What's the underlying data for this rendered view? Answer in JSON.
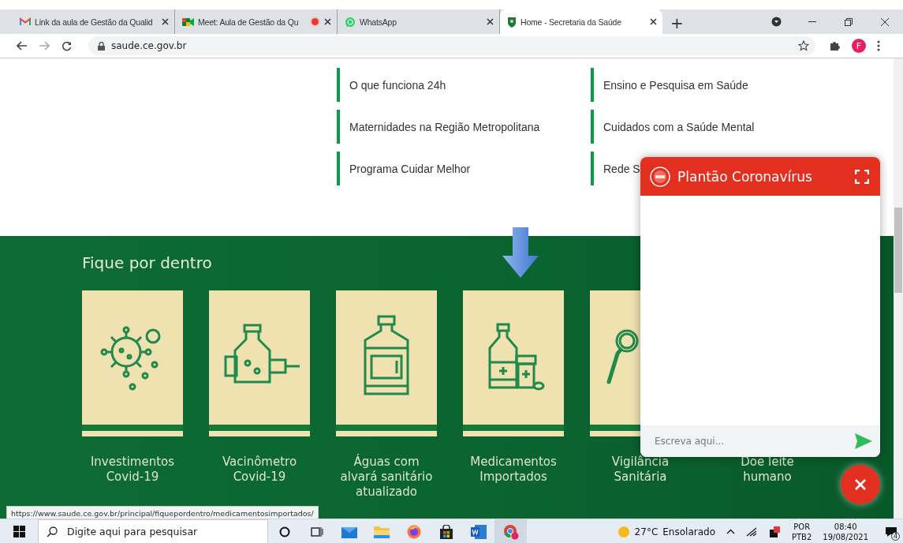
{
  "browser": {
    "tabs": [
      {
        "kind": "gmail",
        "title": "Link da aula de Gestão da Qualid",
        "selected": false,
        "recording": false
      },
      {
        "kind": "meet",
        "title": "Meet: Aula de Gestão da Qu",
        "selected": false,
        "recording": true
      },
      {
        "kind": "whatsapp",
        "title": "WhatsApp",
        "selected": false,
        "recording": false
      },
      {
        "kind": "site",
        "title": "Home - Secretaria da Saúde",
        "selected": true,
        "recording": false
      }
    ],
    "new_tab": "+",
    "address": "saude.ce.gov.br",
    "profile": "F"
  },
  "links": [
    {
      "label": "O que funciona 24h"
    },
    {
      "label": "Ensino e Pesquisa em Saúde"
    },
    {
      "label": "Maternidades na Região Metropolitana"
    },
    {
      "label": "Cuidados com a Saúde Mental"
    },
    {
      "label": "Programa Cuidar Melhor"
    },
    {
      "label": "Rede S"
    }
  ],
  "section": {
    "heading": "Fique por dentro",
    "cards": [
      {
        "label": "Investimentos\nCovid-19"
      },
      {
        "label": "Vacinômetro\nCovid-19"
      },
      {
        "label": "Águas com\nalvará sanitário\natualizado"
      },
      {
        "label": "Medicamentos\nImportados"
      },
      {
        "label": "Vigilância\nSanitária"
      },
      {
        "label": "Doe leite\nhumano"
      }
    ]
  },
  "chat": {
    "title": "Plantão Coronavírus",
    "placeholder": "Escreva aqui..."
  },
  "status_url": "https://www.saude.ce.gov.br/principal/fiquepordentro/medicamentosimportados/",
  "taskbar": {
    "search_placeholder": "Digite aqui para pesquisar",
    "temperature": "27°C",
    "weather": "Ensolarado",
    "language": "POR",
    "layout": "PTB2",
    "time": "08:40",
    "date": "19/08/2021",
    "notifications": "4"
  }
}
